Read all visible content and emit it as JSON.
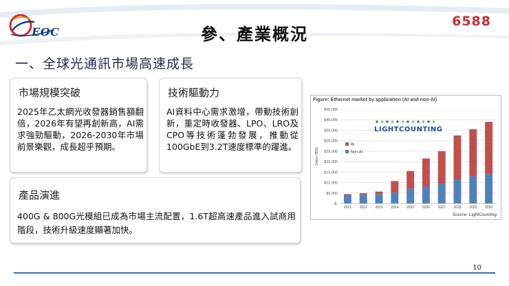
{
  "header": {
    "logo_text": "EOC",
    "stock_code": "6588",
    "title": "參、產業概況"
  },
  "subtitle": "一、全球光通訊市場高速成長",
  "cards": {
    "market": {
      "title": "市場規模突破",
      "body": "2025年乙太網光收發器銷售額翻倍，2026年有望再創新高，AI需求強勁驅動，2026-2030年市場前景樂觀，成長超乎預期。"
    },
    "tech": {
      "title": "技術驅動力",
      "body": "AI資料中心需求激增，帶動技術創新，重定時收發器、LPO、LRO及CPO等技術蓬勃發展，推動從100GbE到3.2T速度標準的躍進。"
    },
    "products": {
      "title": "產品演進",
      "body": "400G & 800G光模組已成為市場主流配置，1.6T超高速產品進入試商用階段，技術升級速度顯著加快。"
    }
  },
  "figure": {
    "title": "Figure: Ethernet market by application (AI and non-AI)",
    "source": "Source: LightCounting",
    "brand": "LIGHTCOUNTING"
  },
  "chart_data": {
    "type": "bar",
    "stacked": true,
    "title": "Figure: Ethernet market by application (AI and non-AI)",
    "xlabel": "",
    "ylabel": "Sales ($M)",
    "ylim": [
      0,
      45000
    ],
    "yticks": [
      "$-",
      "$5,000",
      "$10,000",
      "$15,000",
      "$20,000",
      "$25,000",
      "$30,000",
      "$35,000",
      "$40,000",
      "$45,000"
    ],
    "categories": [
      "2021",
      "2022",
      "2023",
      "2024",
      "2025",
      "2026",
      "2027",
      "2028",
      "2029",
      "2030"
    ],
    "series": [
      {
        "name": "Non-AI",
        "color": "#4f81bd",
        "values": [
          4000,
          4200,
          4500,
          5200,
          7000,
          8000,
          9500,
          11500,
          13000,
          14000
        ]
      },
      {
        "name": "AI",
        "color": "#c0504d",
        "values": [
          500,
          700,
          1200,
          5500,
          8500,
          13500,
          15500,
          21000,
          22500,
          25000
        ]
      }
    ],
    "legend_position": "upper-left",
    "grid": true
  },
  "footer": {
    "page_number": "10"
  }
}
